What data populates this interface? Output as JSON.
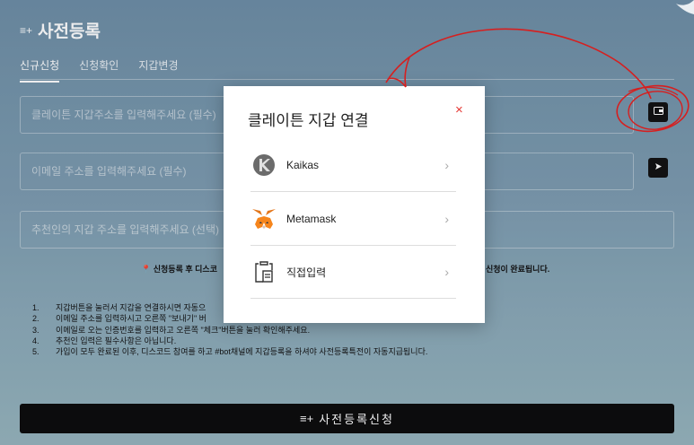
{
  "page": {
    "title_icon": "≡+",
    "title": "사전등록",
    "tabs": [
      {
        "label": "신규신청"
      },
      {
        "label": "신청확인"
      },
      {
        "label": "지갑변경"
      }
    ]
  },
  "form": {
    "wallet_placeholder": "클레이튼 지갑주소를 입력해주세요 (필수)",
    "email_placeholder": "이메일 주소를 입력해주세요 (필수)",
    "referrer_placeholder": "추천인의 지갑 주소를 입력해주세요 (선택)",
    "wallet_button_icon": "wallet-icon",
    "send_button_icon": "send-arrow-icon"
  },
  "notice": {
    "left": "신청등록 후 디스코",
    "right": "신청이 완료됩니다."
  },
  "instructions": [
    {
      "num": "1.",
      "text": "지갑버튼을 눌러서 지갑을 연결하시면 자동으"
    },
    {
      "num": "2.",
      "text": "이메일 주소를 입력하시고 오른쪽 \"보내기\" 버"
    },
    {
      "num": "3.",
      "text": "이메일로 오는 인증번호를 입력하고 오른쪽 \"체크\"버튼을 눌러 확인해주세요."
    },
    {
      "num": "4.",
      "text": "추천인 입력은 필수사항은 아닙니다."
    },
    {
      "num": "5.",
      "text": "가입이 모두 완료된 이후, 디스코드 참여를 하고 #bot채널에 지갑등록을 하셔야 사전등록특전이 자동지급됩니다."
    }
  ],
  "submit": {
    "icon": "≡+",
    "label": "사전등록신청"
  },
  "modal": {
    "title": "클레이튼 지갑 연결",
    "close": "×",
    "options": [
      {
        "label": "Kaikas",
        "icon": "kaikas-logo-icon"
      },
      {
        "label": "Metamask",
        "icon": "metamask-fox-icon"
      },
      {
        "label": "직접입력",
        "icon": "clipboard-icon"
      }
    ],
    "chevron": "›"
  },
  "colors": {
    "accent_dark": "#0b0b0b",
    "close_red": "#e53935",
    "annotation_red": "#d61f1f"
  }
}
